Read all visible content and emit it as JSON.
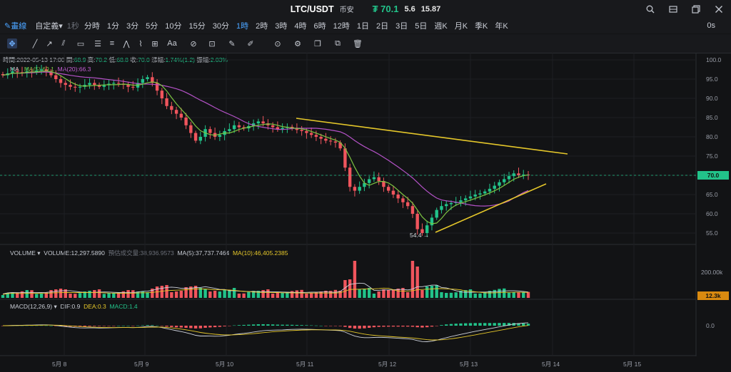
{
  "window": {
    "symbol": "LTC/USDT",
    "exchange": "币安",
    "price": "₮ 70.1",
    "change": "5.6",
    "change_pct": "15.87",
    "controls": [
      "search-icon",
      "gear-icon",
      "restore-icon",
      "close-icon"
    ]
  },
  "timeframes": {
    "draw_label": "畫線",
    "custom_label": "自定義",
    "seconds_label": "1秒",
    "items": [
      "分時",
      "1分",
      "3分",
      "5分",
      "10分",
      "15分",
      "30分",
      "1時",
      "2時",
      "3時",
      "4時",
      "6時",
      "12時",
      "1日",
      "2日",
      "3日",
      "5日",
      "週K",
      "月K",
      "季K",
      "年K"
    ],
    "active": "1時",
    "right_label": "0s"
  },
  "colors": {
    "bg": "#121315",
    "up": "#22c38a",
    "down": "#f0555d",
    "accent": "#4aa3ff",
    "trend": "#e5c72a",
    "ma5": "#7dc542",
    "ma20": "#b452c7",
    "dif": "#cfd3dc",
    "dea": "#e5c72a"
  },
  "ohlc": {
    "time_label": "時間:",
    "time": "2022-05-13 17:00",
    "open_label": "開:",
    "open": "68.9",
    "high_label": "高:",
    "high": "70.2",
    "low_label": "低:",
    "low": "68.8",
    "close_label": "收:",
    "close": "70.0",
    "change_label": "漲幅:",
    "change": "1.74%(1.2)",
    "amp_label": "振幅:",
    "amplitude": "2.03%"
  },
  "ma_legend": {
    "name": "MA",
    "ma5": "MA(5):69.1",
    "ma20": "MA(20):66.3"
  },
  "vol_legend": {
    "name": "VOLUME",
    "volume": "VOLUME:12,297.5890",
    "estimated": "預估成交量:38,936.9573",
    "ma5": "MA(5):37,737.7464",
    "ma10": "MA(10):46,405.2385"
  },
  "macd_legend": {
    "name": "MACD(12,26,9)",
    "dif": "DIF:0.9",
    "dea": "DEA:0.3",
    "macd": "MACD:1.4"
  },
  "price_axis": [
    "100.0",
    "95.0",
    "90.0",
    "85.0",
    "80.0",
    "75.0",
    "70.0",
    "65.0",
    "60.0",
    "55.0"
  ],
  "current_price_tag": "70.0",
  "low_marker": "54.4",
  "vol_axis": "200.00k",
  "vol_tag": "12.3k",
  "macd_axis": "0.0",
  "x_axis": [
    "5月 8",
    "5月 9",
    "5月 10",
    "5月 11",
    "5月 12",
    "5月 13",
    "5月 14",
    "5月 15"
  ],
  "chart_data": {
    "type": "candlestick",
    "title": "LTC/USDT 1時",
    "ylim": [
      53,
      101
    ],
    "close_path": [
      96,
      96.5,
      97,
      96.8,
      96.5,
      97,
      96.8,
      97.2,
      97.5,
      97,
      96,
      95,
      94,
      93.5,
      93,
      92.8,
      93,
      93.5,
      94,
      93.5,
      93,
      93.4,
      93.8,
      94,
      93.8,
      93.5,
      93,
      92.8,
      94,
      95,
      95.5,
      94,
      92,
      90,
      88,
      87,
      86,
      85,
      83,
      81,
      79,
      80,
      82,
      81,
      80,
      80.5,
      81.5,
      82,
      83,
      82.5,
      82.2,
      82.8,
      83.5,
      84,
      83.5,
      83,
      82.5,
      82,
      82.3,
      82.6,
      82.2,
      81.8,
      81.5,
      81,
      80.5,
      80,
      79.5,
      79,
      78.8,
      78.5,
      77,
      72,
      67,
      66,
      67,
      68,
      69,
      69.5,
      68.5,
      67,
      66,
      65,
      64,
      63,
      62,
      60,
      56,
      55,
      57,
      59,
      61,
      62,
      62.5,
      62.8,
      63,
      63.5,
      64,
      64.5,
      65,
      65.3,
      65.8,
      66.5,
      67.3,
      68.2,
      69,
      69.8,
      70.5,
      70,
      70.2,
      70.1
    ],
    "ma_periods": [
      5,
      20
    ],
    "trendlines": [
      {
        "name": "upper",
        "from": [
          415,
          166
        ],
        "to": [
          795,
          216
        ]
      },
      {
        "name": "lower",
        "from": [
          610,
          326
        ],
        "to": [
          765,
          258
        ]
      }
    ]
  }
}
